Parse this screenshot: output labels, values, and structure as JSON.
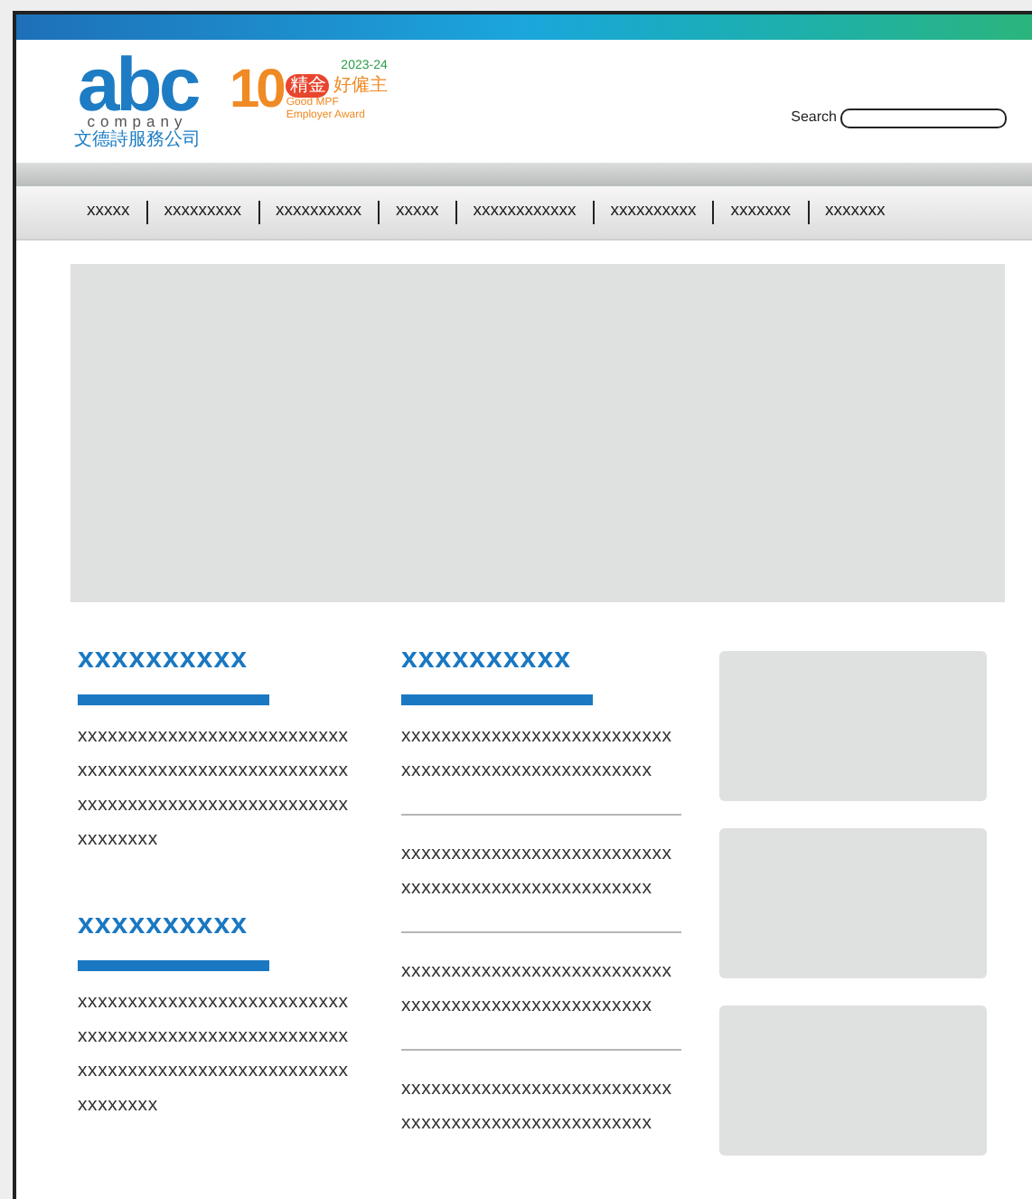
{
  "header": {
    "logo": {
      "wordmark": "abc",
      "subtitle": "company",
      "chinese_name": "文德詩服務公司"
    },
    "award": {
      "number": "10",
      "badge": "精金",
      "title": "好僱主",
      "years": "2023-24",
      "english_lines": [
        "Good MPF",
        "Employer Award"
      ]
    },
    "search": {
      "label": "Search"
    }
  },
  "nav": {
    "items": [
      "xxxxx",
      "xxxxxxxxx",
      "xxxxxxxxxx",
      "xxxxx",
      "xxxxxxxxxxxx",
      "xxxxxxxxxx",
      "xxxxxxx",
      "xxxxxxx"
    ]
  },
  "hero": {
    "kind": "placeholder"
  },
  "left_sections": [
    {
      "heading": "xxxxxxxxxx",
      "lines": [
        "xxxxxxxxxxxxxxxxxxxxxxxxxxx",
        "xxxxxxxxxxxxxxxxxxxxxxxxxxx",
        "xxxxxxxxxxxxxxxxxxxxxxxxxxx",
        "xxxxxxxx"
      ]
    },
    {
      "heading": "xxxxxxxxxx",
      "lines": [
        "xxxxxxxxxxxxxxxxxxxxxxxxxxx",
        "xxxxxxxxxxxxxxxxxxxxxxxxxxx",
        "xxxxxxxxxxxxxxxxxxxxxxxxxxx",
        "xxxxxxxx"
      ]
    }
  ],
  "news": {
    "heading": "xxxxxxxxxx",
    "items": [
      {
        "lines": [
          "xxxxxxxxxxxxxxxxxxxxxxxxxxx",
          "xxxxxxxxxxxxxxxxxxxxxxxxx"
        ]
      },
      {
        "lines": [
          "xxxxxxxxxxxxxxxxxxxxxxxxxxx",
          "xxxxxxxxxxxxxxxxxxxxxxxxx"
        ]
      },
      {
        "lines": [
          "xxxxxxxxxxxxxxxxxxxxxxxxxxx",
          "xxxxxxxxxxxxxxxxxxxxxxxxx"
        ]
      },
      {
        "lines": [
          "xxxxxxxxxxxxxxxxxxxxxxxxxxx",
          "xxxxxxxxxxxxxxxxxxxxxxxxx"
        ]
      }
    ]
  },
  "side_boxes": [
    {
      "kind": "placeholder"
    },
    {
      "kind": "placeholder"
    },
    {
      "kind": "placeholder"
    }
  ]
}
